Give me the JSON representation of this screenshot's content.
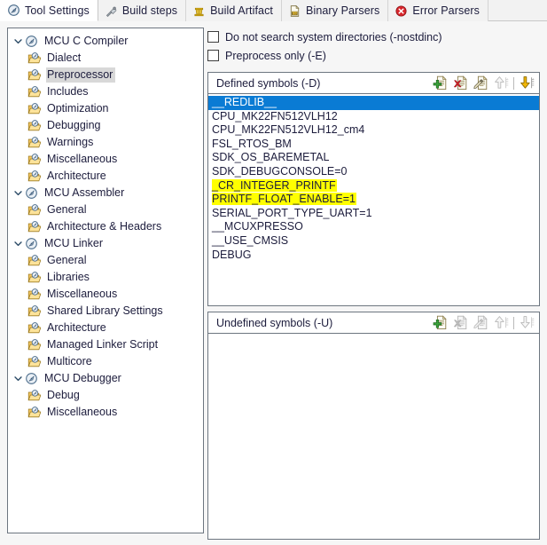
{
  "tabs": [
    {
      "label": "Tool Settings",
      "icon": "settings-disc-icon",
      "active": true
    },
    {
      "label": "Build steps",
      "icon": "build-steps-icon",
      "active": false
    },
    {
      "label": "Build Artifact",
      "icon": "build-artifact-icon",
      "active": false
    },
    {
      "label": "Binary Parsers",
      "icon": "binary-parsers-icon",
      "active": false
    },
    {
      "label": "Error Parsers",
      "icon": "error-parsers-icon",
      "active": false
    }
  ],
  "tree": [
    {
      "label": "MCU C Compiler",
      "level": 0,
      "expanded": true,
      "selected": false
    },
    {
      "label": "Dialect",
      "level": 1,
      "expanded": null,
      "selected": false
    },
    {
      "label": "Preprocessor",
      "level": 1,
      "expanded": null,
      "selected": true
    },
    {
      "label": "Includes",
      "level": 1,
      "expanded": null,
      "selected": false
    },
    {
      "label": "Optimization",
      "level": 1,
      "expanded": null,
      "selected": false
    },
    {
      "label": "Debugging",
      "level": 1,
      "expanded": null,
      "selected": false
    },
    {
      "label": "Warnings",
      "level": 1,
      "expanded": null,
      "selected": false
    },
    {
      "label": "Miscellaneous",
      "level": 1,
      "expanded": null,
      "selected": false
    },
    {
      "label": "Architecture",
      "level": 1,
      "expanded": null,
      "selected": false
    },
    {
      "label": "MCU Assembler",
      "level": 0,
      "expanded": true,
      "selected": false
    },
    {
      "label": "General",
      "level": 1,
      "expanded": null,
      "selected": false
    },
    {
      "label": "Architecture & Headers",
      "level": 1,
      "expanded": null,
      "selected": false
    },
    {
      "label": "MCU Linker",
      "level": 0,
      "expanded": true,
      "selected": false
    },
    {
      "label": "General",
      "level": 1,
      "expanded": null,
      "selected": false
    },
    {
      "label": "Libraries",
      "level": 1,
      "expanded": null,
      "selected": false
    },
    {
      "label": "Miscellaneous",
      "level": 1,
      "expanded": null,
      "selected": false
    },
    {
      "label": "Shared Library Settings",
      "level": 1,
      "expanded": null,
      "selected": false
    },
    {
      "label": "Architecture",
      "level": 1,
      "expanded": null,
      "selected": false
    },
    {
      "label": "Managed Linker Script",
      "level": 1,
      "expanded": null,
      "selected": false
    },
    {
      "label": "Multicore",
      "level": 1,
      "expanded": null,
      "selected": false
    },
    {
      "label": "MCU Debugger",
      "level": 0,
      "expanded": true,
      "selected": false
    },
    {
      "label": "Debug",
      "level": 1,
      "expanded": null,
      "selected": false
    },
    {
      "label": "Miscellaneous",
      "level": 1,
      "expanded": null,
      "selected": false
    }
  ],
  "checkboxes": [
    {
      "label": "Do not search system directories (-nostdinc)",
      "checked": false
    },
    {
      "label": "Preprocess only (-E)",
      "checked": false
    }
  ],
  "defined_group": {
    "title": "Defined symbols (-D)",
    "tools": [
      {
        "name": "add-icon",
        "enabled": true
      },
      {
        "name": "delete-icon",
        "enabled": true
      },
      {
        "name": "edit-icon",
        "enabled": true
      },
      {
        "name": "move-up-icon",
        "enabled": false
      },
      {
        "name": "move-down-icon",
        "enabled": true
      }
    ],
    "items": [
      {
        "text": "__REDLIB__",
        "selected": true,
        "highlighted": false
      },
      {
        "text": "CPU_MK22FN512VLH12",
        "selected": false,
        "highlighted": false
      },
      {
        "text": "CPU_MK22FN512VLH12_cm4",
        "selected": false,
        "highlighted": false
      },
      {
        "text": "FSL_RTOS_BM",
        "selected": false,
        "highlighted": false
      },
      {
        "text": "SDK_OS_BAREMETAL",
        "selected": false,
        "highlighted": false
      },
      {
        "text": "SDK_DEBUGCONSOLE=0",
        "selected": false,
        "highlighted": false
      },
      {
        "text": "_CR_INTEGER_PRINTF",
        "selected": false,
        "highlighted": true
      },
      {
        "text": "PRINTF_FLOAT_ENABLE=1",
        "selected": false,
        "highlighted": true
      },
      {
        "text": "SERIAL_PORT_TYPE_UART=1",
        "selected": false,
        "highlighted": false
      },
      {
        "text": "__MCUXPRESSO",
        "selected": false,
        "highlighted": false
      },
      {
        "text": "__USE_CMSIS",
        "selected": false,
        "highlighted": false
      },
      {
        "text": "DEBUG",
        "selected": false,
        "highlighted": false
      }
    ]
  },
  "undefined_group": {
    "title": "Undefined symbols (-U)",
    "tools": [
      {
        "name": "add-icon",
        "enabled": true
      },
      {
        "name": "delete-icon",
        "enabled": false
      },
      {
        "name": "edit-icon",
        "enabled": false
      },
      {
        "name": "move-up-icon",
        "enabled": false
      },
      {
        "name": "move-down-icon",
        "enabled": false
      }
    ],
    "items": []
  },
  "colors": {
    "selection_blue": "#0a7bd4",
    "highlight_yellow": "#ffff00",
    "tree_selection_gray": "#d8d8d8",
    "panel_border": "#6d7680",
    "text": "#1c1c3c"
  }
}
